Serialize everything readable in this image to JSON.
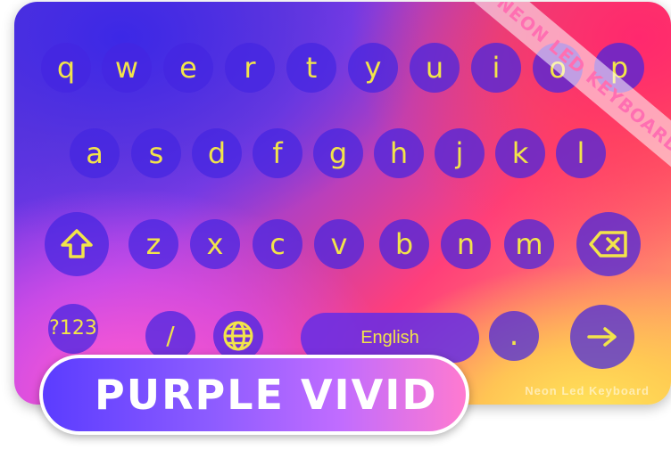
{
  "branding": {
    "ribbon_text": "NEON LED KEYBOARD",
    "watermark_text": "Neon Led Keyboard",
    "theme_name": "PURPLE VIVID"
  },
  "keyboard": {
    "row1": [
      "q",
      "w",
      "e",
      "r",
      "t",
      "y",
      "u",
      "i",
      "o",
      "p"
    ],
    "row2": [
      "a",
      "s",
      "d",
      "f",
      "g",
      "h",
      "j",
      "k",
      "l"
    ],
    "row3": [
      "z",
      "x",
      "c",
      "v",
      "b",
      "n",
      "m"
    ],
    "symbols_label": "?123",
    "slash_label": "/",
    "space_label": "English",
    "period_label": "."
  },
  "icons": {
    "shift": "shift-arrow-up-icon",
    "backspace": "backspace-icon",
    "globe": "globe-icon",
    "enter": "arrow-right-icon"
  },
  "colors": {
    "key_text": "#f2e44a",
    "key_bg": "#4426e0",
    "ribbon_text": "#ff6fb2"
  }
}
